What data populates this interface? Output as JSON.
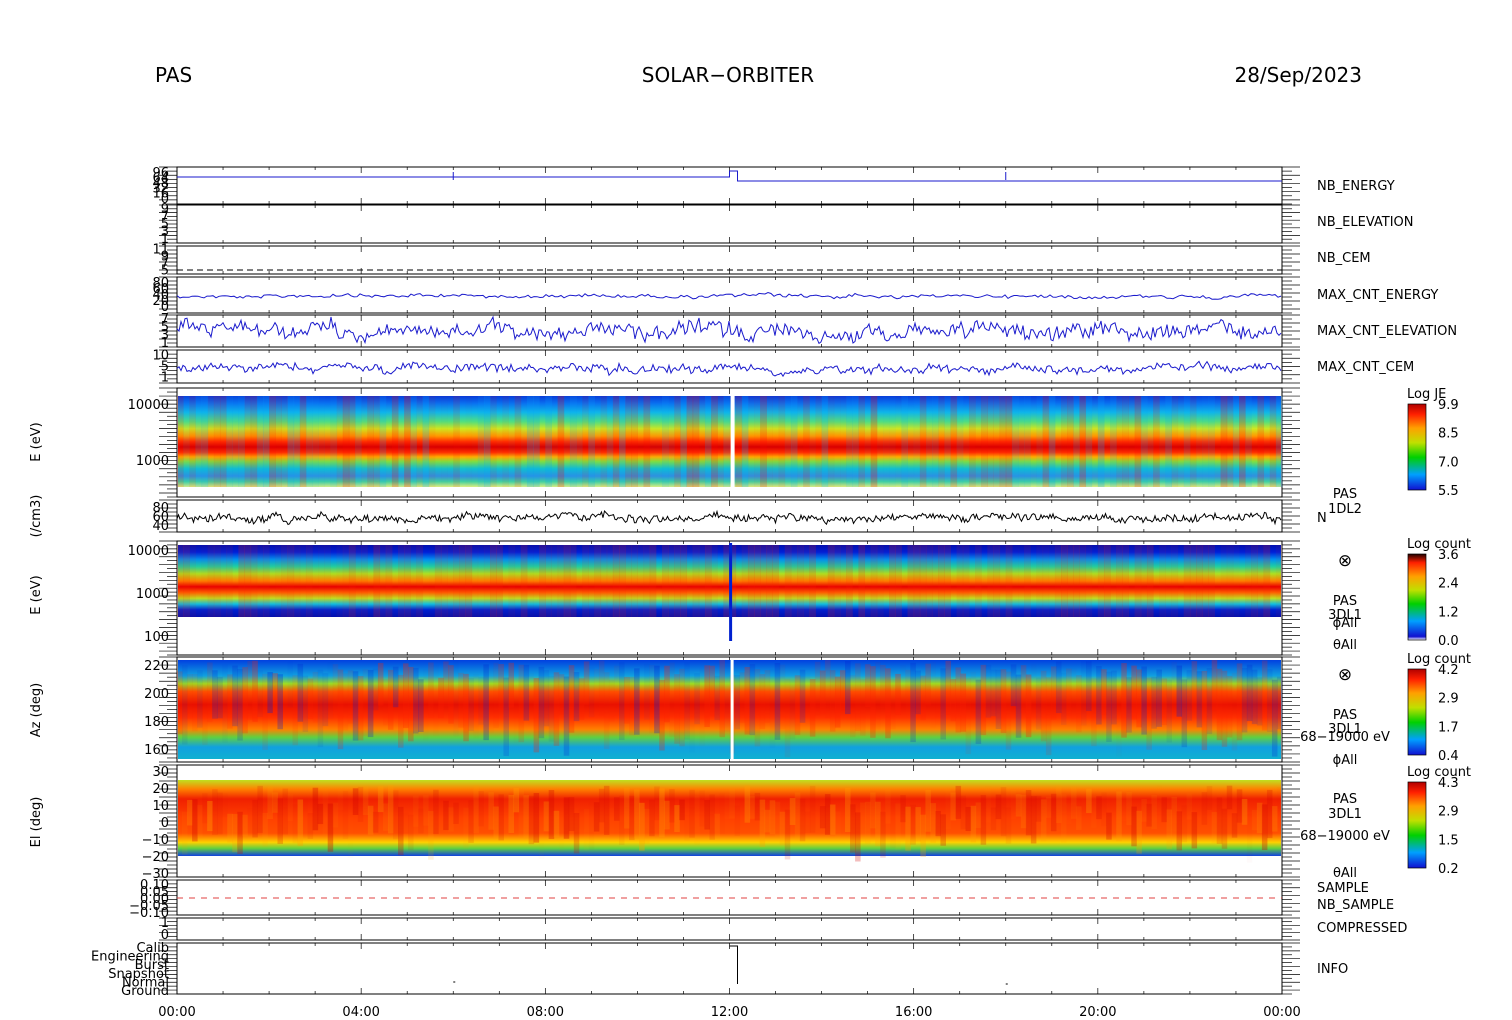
{
  "header": {
    "left": "PAS",
    "center": "SOLAR−ORBITER",
    "right": "28/Sep/2023"
  },
  "colors": {
    "trace_blue": "#1a1acc",
    "trace_black": "#000000",
    "nb_sample_red": "#e04040",
    "label_blue": "#1a1aa8",
    "label_red": "#d01010"
  },
  "chart_data": {
    "type": "spectrogram-stack",
    "time_axis": {
      "ticks": [
        "00:00",
        "04:00",
        "08:00",
        "12:00",
        "16:00",
        "20:00",
        "00:00"
      ],
      "range_hours": [
        0,
        24
      ]
    },
    "panels": [
      {
        "id": "nb_energy",
        "label": "NB_ENERGY",
        "label_color": "blue",
        "yticks": [
          "96",
          "64",
          "48",
          "32",
          "16",
          "0"
        ],
        "type": "line"
      },
      {
        "id": "nb_elevation",
        "label": "NB_ELEVATION",
        "label_color": "blue",
        "yticks": [
          "9",
          "7",
          "5",
          "3",
          "1"
        ],
        "type": "line"
      },
      {
        "id": "nb_cem",
        "label": "NB_CEM",
        "label_color": "blue",
        "yticks": [
          "11",
          "9",
          "7",
          "5"
        ],
        "type": "line"
      },
      {
        "id": "max_cnt_energy",
        "label": "MAX_CNT_ENERGY",
        "label_color": "blue",
        "yticks": [
          "80",
          "60",
          "40",
          "20",
          "0"
        ],
        "type": "line"
      },
      {
        "id": "max_cnt_elevation",
        "label": "MAX_CNT_ELEVATION",
        "label_color": "blue",
        "yticks": [
          "7",
          "5",
          "3",
          "1"
        ],
        "type": "line"
      },
      {
        "id": "max_cnt_cem",
        "label": "MAX_CNT_CEM",
        "label_color": "blue",
        "yticks": [
          "10",
          "5",
          "1"
        ],
        "type": "line"
      },
      {
        "id": "energy_je",
        "ylabel": "E (eV)",
        "yticks": [
          "10000",
          "1000"
        ],
        "colorbar": {
          "title": "Log JE",
          "ticks": [
            "9.9",
            "8.5",
            "7.0",
            "5.5"
          ]
        },
        "type": "heatmap"
      },
      {
        "id": "density",
        "ylabel": "(/cm3)",
        "yticks": [
          "80",
          "60",
          "40"
        ],
        "side_labels": [
          "PAS",
          "1DL2",
          "N"
        ],
        "type": "line",
        "y_range": [
          30,
          90
        ]
      },
      {
        "id": "energy_count",
        "ylabel": "E (eV)",
        "yticks": [
          "10000",
          "1000",
          "100"
        ],
        "side_labels": [
          "⊗",
          "PAS",
          "3DL1",
          "ϕAll",
          "θAll"
        ],
        "colorbar": {
          "title": "Log count",
          "ticks": [
            "3.6",
            "2.4",
            "1.2",
            "0.0"
          ]
        },
        "type": "heatmap"
      },
      {
        "id": "azimuth",
        "ylabel": "Az (deg)",
        "yticks": [
          "220",
          "200",
          "180",
          "160"
        ],
        "side_labels": [
          "⊗",
          "PAS",
          "3DL1",
          "68−19000 eV",
          "ϕAll"
        ],
        "colorbar": {
          "title": "Log count",
          "ticks": [
            "4.2",
            "2.9",
            "1.7",
            "0.4"
          ]
        },
        "type": "heatmap"
      },
      {
        "id": "elevation",
        "ylabel": "El (deg)",
        "yticks": [
          "30",
          "20",
          "10",
          "0",
          "−10",
          "−20",
          "−30"
        ],
        "side_labels": [
          "PAS",
          "3DL1",
          "68−19000 eV",
          "θAll"
        ],
        "colorbar": {
          "title": "Log count",
          "ticks": [
            "4.3",
            "2.9",
            "1.5",
            "0.2"
          ]
        },
        "type": "heatmap"
      },
      {
        "id": "sample",
        "labels": [
          "SAMPLE",
          "NB_SAMPLE"
        ],
        "label_colors": [
          "blue",
          "red"
        ],
        "yticks": [
          "0.10",
          "0.05",
          "0.00",
          "−0.05",
          "−0.10"
        ],
        "type": "line"
      },
      {
        "id": "compressed",
        "label": "COMPRESSED",
        "label_color": "blue",
        "yticks": [
          "1",
          "0"
        ],
        "type": "line"
      },
      {
        "id": "info",
        "label": "INFO",
        "label_color": "black",
        "yticks": [
          "Calib",
          "Engineering",
          "Burst",
          "Snapshot",
          "Normal",
          "Ground"
        ],
        "type": "line"
      }
    ]
  }
}
